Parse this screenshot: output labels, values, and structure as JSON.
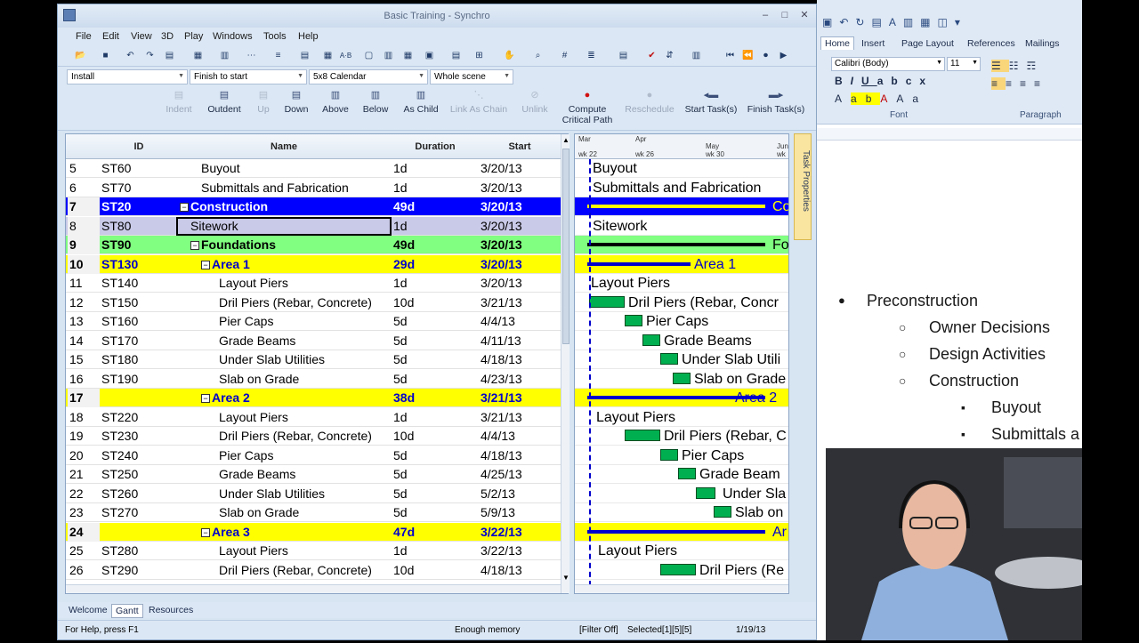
{
  "window": {
    "title": "Basic Training - Synchro",
    "min": "–",
    "max": "□",
    "close": "✕"
  },
  "menu": [
    "File",
    "Edit",
    "View",
    "3D",
    "Play",
    "Windows",
    "Tools",
    "Help"
  ],
  "toolbar2": {
    "install": "Install",
    "finish_to_start": "Finish to start",
    "calendar": "5x8 Calendar",
    "scene": "Whole scene"
  },
  "taskbar": {
    "indent": "Indent",
    "outdent": "Outdent",
    "up": "Up",
    "down": "Down",
    "above": "Above",
    "below": "Below",
    "as_child": "As Child",
    "link_as_chain": "Link As Chain",
    "unlink": "Unlink",
    "compute_l1": "Compute",
    "compute_l2": "Critical Path",
    "reschedule": "Reschedule",
    "start_tasks": "Start Task(s)",
    "finish_tasks": "Finish Task(s)"
  },
  "grid": {
    "headers": {
      "id": "ID",
      "name": "Name",
      "duration": "Duration",
      "start": "Start"
    },
    "rows": [
      {
        "n": "5",
        "id": "ST60",
        "name": "Buyout",
        "dur": "1d",
        "start": "3/20/13",
        "style": "",
        "indent": "2",
        "minus": ""
      },
      {
        "n": "6",
        "id": "ST70",
        "name": "Submittals and Fabrication",
        "dur": "1d",
        "start": "3/20/13",
        "style": "",
        "indent": "2",
        "minus": ""
      },
      {
        "n": "7",
        "id": "ST20",
        "name": "Construction",
        "dur": "49d",
        "start": "3/20/13",
        "style": "blue",
        "indent": "0",
        "minus": "−"
      },
      {
        "n": "8",
        "id": "ST80",
        "name": "Sitework",
        "dur": "1d",
        "start": "3/20/13",
        "style": "sel",
        "indent": "1",
        "minus": ""
      },
      {
        "n": "9",
        "id": "ST90",
        "name": "Foundations",
        "dur": "49d",
        "start": "3/20/13",
        "style": "green",
        "indent": "1",
        "minus": "−"
      },
      {
        "n": "10",
        "id": "ST130",
        "name": "Area 1",
        "dur": "29d",
        "start": "3/20/13",
        "style": "yellow",
        "indent": "2",
        "minus": "−"
      },
      {
        "n": "11",
        "id": "ST140",
        "name": "Layout Piers",
        "dur": "1d",
        "start": "3/20/13",
        "style": "",
        "indent": "3",
        "minus": ""
      },
      {
        "n": "12",
        "id": "ST150",
        "name": "Dril Piers (Rebar, Concrete)",
        "dur": "10d",
        "start": "3/21/13",
        "style": "",
        "indent": "3",
        "minus": ""
      },
      {
        "n": "13",
        "id": "ST160",
        "name": "Pier Caps",
        "dur": "5d",
        "start": "4/4/13",
        "style": "",
        "indent": "3",
        "minus": ""
      },
      {
        "n": "14",
        "id": "ST170",
        "name": "Grade Beams",
        "dur": "5d",
        "start": "4/11/13",
        "style": "",
        "indent": "3",
        "minus": ""
      },
      {
        "n": "15",
        "id": "ST180",
        "name": "Under Slab Utilities",
        "dur": "5d",
        "start": "4/18/13",
        "style": "",
        "indent": "3",
        "minus": ""
      },
      {
        "n": "16",
        "id": "ST190",
        "name": "Slab on Grade",
        "dur": "5d",
        "start": "4/23/13",
        "style": "",
        "indent": "3",
        "minus": ""
      },
      {
        "n": "17",
        "id": "",
        "name": "Area 2",
        "dur": "38d",
        "start": "3/21/13",
        "style": "yellow",
        "indent": "2",
        "minus": "−"
      },
      {
        "n": "18",
        "id": "ST220",
        "name": "Layout Piers",
        "dur": "1d",
        "start": "3/21/13",
        "style": "",
        "indent": "3",
        "minus": ""
      },
      {
        "n": "19",
        "id": "ST230",
        "name": "Dril Piers (Rebar, Concrete)",
        "dur": "10d",
        "start": "4/4/13",
        "style": "",
        "indent": "3",
        "minus": ""
      },
      {
        "n": "20",
        "id": "ST240",
        "name": "Pier Caps",
        "dur": "5d",
        "start": "4/18/13",
        "style": "",
        "indent": "3",
        "minus": ""
      },
      {
        "n": "21",
        "id": "ST250",
        "name": "Grade Beams",
        "dur": "5d",
        "start": "4/25/13",
        "style": "",
        "indent": "3",
        "minus": ""
      },
      {
        "n": "22",
        "id": "ST260",
        "name": "Under Slab Utilities",
        "dur": "5d",
        "start": "5/2/13",
        "style": "",
        "indent": "3",
        "minus": ""
      },
      {
        "n": "23",
        "id": "ST270",
        "name": "Slab on Grade",
        "dur": "5d",
        "start": "5/9/13",
        "style": "",
        "indent": "3",
        "minus": ""
      },
      {
        "n": "24",
        "id": "",
        "name": "Area 3",
        "dur": "47d",
        "start": "3/22/13",
        "style": "yellow",
        "indent": "2",
        "minus": "−"
      },
      {
        "n": "25",
        "id": "ST280",
        "name": "Layout Piers",
        "dur": "1d",
        "start": "3/22/13",
        "style": "",
        "indent": "3",
        "minus": ""
      },
      {
        "n": "26",
        "id": "ST290",
        "name": "Dril Piers (Rebar, Concrete)",
        "dur": "10d",
        "start": "4/18/13",
        "style": "",
        "indent": "3",
        "minus": ""
      }
    ]
  },
  "gantt": {
    "months": [
      "Mar",
      "Apr",
      "May",
      "Jun"
    ],
    "weeks": [
      "wk 22",
      "wk 26",
      "wk 30",
      "wk"
    ],
    "labels": [
      "Buyout",
      "Submittals and Fabrication",
      "Co",
      "Sitework",
      "Fo",
      "Area 1",
      "Layout Piers",
      "Dril Piers (Rebar, Concr",
      "Pier Caps",
      "Grade Beams",
      "Under Slab Utili",
      "Slab on Grade",
      "Area 2",
      "Layout Piers",
      "Dril Piers (Rebar, C",
      "Pier Caps",
      "Grade Beam",
      "Under Sla",
      "Slab on",
      "Ar",
      "Layout Piers",
      "Dril Piers (Re"
    ]
  },
  "task_properties": "Task Properties",
  "bottom_tabs": [
    "Welcome",
    "Gantt",
    "Resources"
  ],
  "status": {
    "help": "For Help, press F1",
    "memory": "Enough memory",
    "filter": "[Filter Off]",
    "selected": "Selected[1][5][5]",
    "date": "1/19/13"
  },
  "word": {
    "tabs": [
      "Home",
      "Insert",
      "Page Layout",
      "References",
      "Mailings"
    ],
    "font": "Calibri (Body)",
    "size": "11",
    "group_font": "Font",
    "group_paragraph": "Paragraph",
    "bullets": [
      {
        "level": 1,
        "marker": "●",
        "text": "Preconstruction"
      },
      {
        "level": 2,
        "marker": "○",
        "text": "Owner Decisions"
      },
      {
        "level": 2,
        "marker": "○",
        "text": "Design Activities"
      },
      {
        "level": 2,
        "marker": "○",
        "text": "Construction"
      },
      {
        "level": 3,
        "marker": "▪",
        "text": "Buyout"
      },
      {
        "level": 3,
        "marker": "▪",
        "text": "Submittals a"
      }
    ]
  }
}
